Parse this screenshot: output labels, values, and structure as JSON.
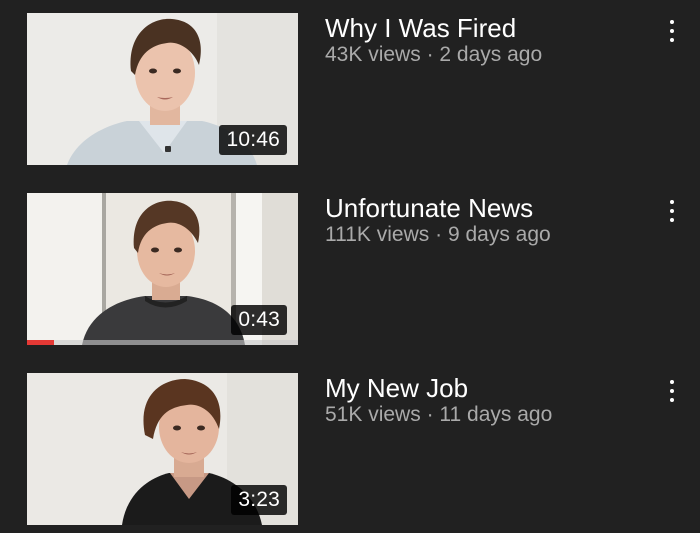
{
  "videos": [
    {
      "title": "Why I Was Fired",
      "views": "43K views",
      "separator": "·",
      "age": "2 days ago",
      "duration": "10:46",
      "watched_fraction": 0
    },
    {
      "title": "Unfortunate News",
      "views": "111K views",
      "separator": "·",
      "age": "9 days ago",
      "duration": "0:43",
      "watched_fraction": 0.1
    },
    {
      "title": "My New Job",
      "views": "51K views",
      "separator": "·",
      "age": "11 days ago",
      "duration": "3:23",
      "watched_fraction": 0
    }
  ],
  "colors": {
    "background": "#212121",
    "progress": "#e53935",
    "title": "#ffffff",
    "meta": "#aaaaaa"
  },
  "icons": {
    "menu": "more-vertical-icon"
  }
}
